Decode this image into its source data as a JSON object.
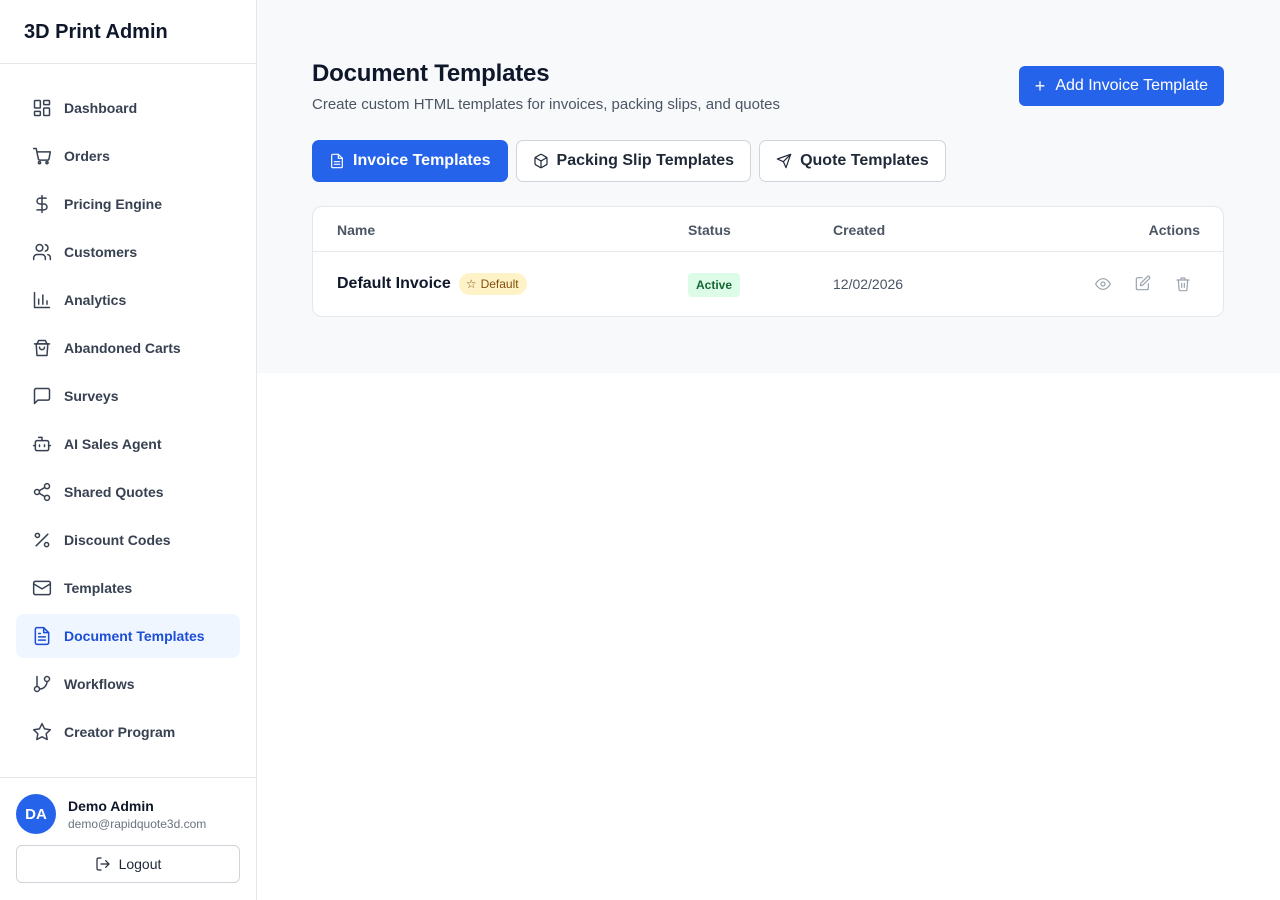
{
  "app": {
    "title": "3D Print Admin"
  },
  "sidebar": {
    "items": [
      {
        "label": "Dashboard",
        "icon": "dashboard-icon"
      },
      {
        "label": "Orders",
        "icon": "cart-icon"
      },
      {
        "label": "Pricing Engine",
        "icon": "dollar-icon"
      },
      {
        "label": "Customers",
        "icon": "users-icon"
      },
      {
        "label": "Analytics",
        "icon": "bar-chart-icon"
      },
      {
        "label": "Abandoned Carts",
        "icon": "shopping-bag-icon"
      },
      {
        "label": "Surveys",
        "icon": "message-square-icon"
      },
      {
        "label": "AI Sales Agent",
        "icon": "bot-icon"
      },
      {
        "label": "Shared Quotes",
        "icon": "share-icon"
      },
      {
        "label": "Discount Codes",
        "icon": "percent-icon"
      },
      {
        "label": "Templates",
        "icon": "mail-icon"
      },
      {
        "label": "Document Templates",
        "icon": "file-text-icon",
        "active": true
      },
      {
        "label": "Workflows",
        "icon": "git-branch-icon"
      },
      {
        "label": "Creator Program",
        "icon": "star-icon"
      }
    ]
  },
  "user": {
    "initials": "DA",
    "name": "Demo Admin",
    "email": "demo@rapidquote3d.com",
    "logout_label": "Logout"
  },
  "header": {
    "title": "Document Templates",
    "subtitle": "Create custom HTML templates for invoices, packing slips, and quotes",
    "add_button_label": "Add Invoice Template"
  },
  "tabs": [
    {
      "label": "Invoice Templates",
      "icon": "file-text-icon",
      "active": true
    },
    {
      "label": "Packing Slip Templates",
      "icon": "package-icon",
      "active": false
    },
    {
      "label": "Quote Templates",
      "icon": "send-icon",
      "active": false
    }
  ],
  "table": {
    "columns": [
      "Name",
      "Status",
      "Created",
      "Actions"
    ],
    "rows": [
      {
        "name": "Default Invoice",
        "badge": "Default",
        "status": "Active",
        "created": "12/02/2026",
        "actions": [
          "eye-icon",
          "edit-icon",
          "trash-icon"
        ]
      }
    ]
  },
  "colors": {
    "accent": "#2563eb",
    "active_nav_bg": "#eff6ff",
    "status_active_bg": "#dcfce7",
    "default_badge_bg": "#fef3c7"
  }
}
